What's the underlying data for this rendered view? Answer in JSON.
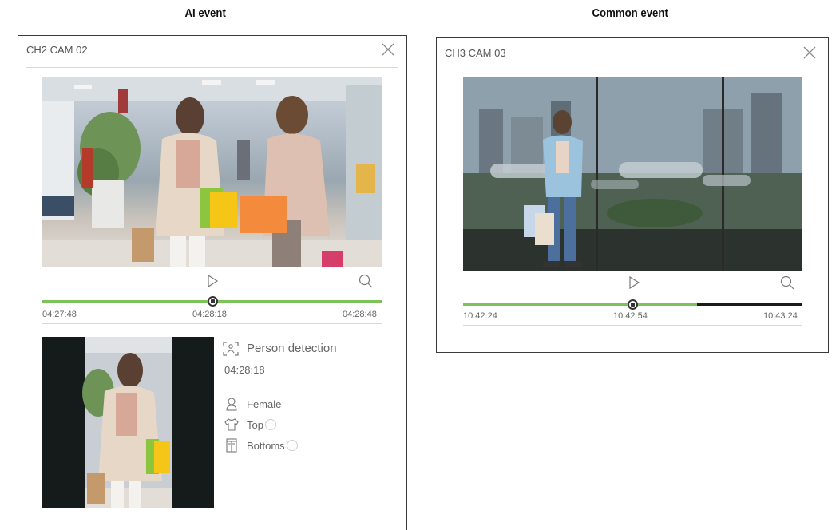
{
  "sections": {
    "ai_title": "AI event",
    "common_title": "Common event"
  },
  "ai_popup": {
    "title": "CH2 CAM 02",
    "time_start": "04:27:48",
    "time_current": "04:28:18",
    "time_end": "04:28:48",
    "progress": 0.5,
    "detection_label": "Person detection",
    "detection_time": "04:28:18",
    "attributes": [
      {
        "icon": "person-icon",
        "label": "Female"
      },
      {
        "icon": "top-clothing-icon",
        "label": "Top"
      },
      {
        "icon": "bottoms-clothing-icon",
        "label": "Bottoms"
      }
    ]
  },
  "common_popup": {
    "title": "CH3 CAM 03",
    "time_start": "10:42:24",
    "time_current": "10:42:54",
    "time_end": "10:43:24",
    "progress": 0.5,
    "recorded_fraction": 0.69
  },
  "colors": {
    "timeline_green": "#7dc35b",
    "timeline_dark": "#1b1b1b",
    "border": "#3a3a3a"
  }
}
